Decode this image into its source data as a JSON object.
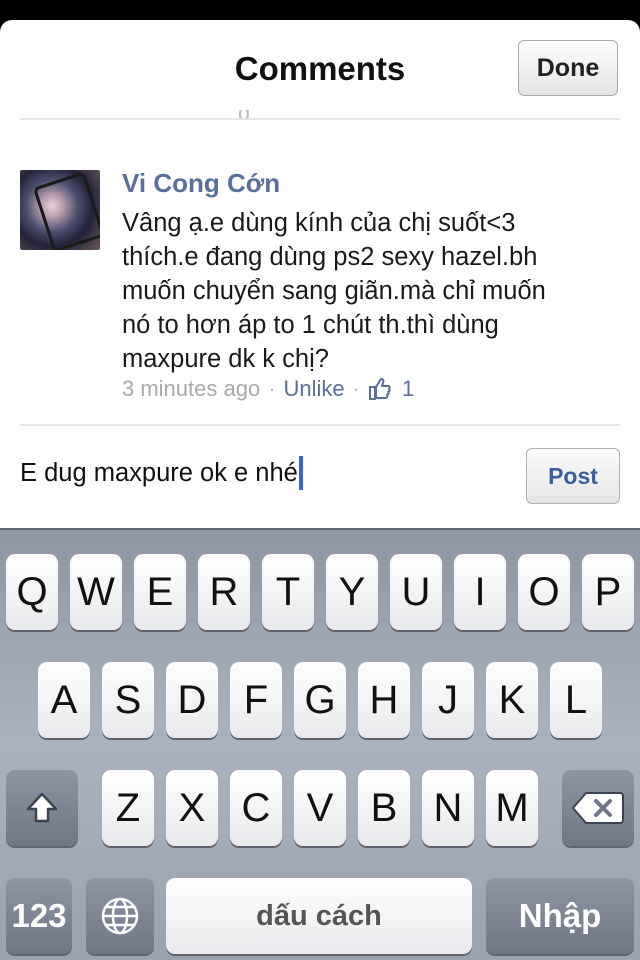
{
  "header": {
    "title": "Comments",
    "done_label": "Done"
  },
  "comment": {
    "author": "Vi Cong Cớn",
    "lines": [
      "Vâng ạ.e dùng kính của chị suốt<3",
      "thích.e đang dùng ps2 sexy hazel.bh",
      "muốn chuyển sang giãn.mà chỉ muốn",
      "nó to hơn áp to 1 chút th.thì dùng",
      "maxpure dk k chị?"
    ],
    "time": "3 minutes ago",
    "separator": "·",
    "unlike_label": "Unlike",
    "like_count": "1"
  },
  "composer": {
    "text": "E dug maxpure ok e nhé",
    "post_label": "Post"
  },
  "keyboard": {
    "row1": [
      "Q",
      "W",
      "E",
      "R",
      "T",
      "Y",
      "U",
      "I",
      "O",
      "P"
    ],
    "row2": [
      "A",
      "S",
      "D",
      "F",
      "G",
      "H",
      "J",
      "K",
      "L"
    ],
    "row3": [
      "Z",
      "X",
      "C",
      "V",
      "B",
      "N",
      "M"
    ],
    "numbers_label": "123",
    "space_label": "dấu cách",
    "return_label": "Nhập"
  },
  "colors": {
    "link": "#5a6f9c",
    "cursor": "#3e63d8",
    "post": "#3a5fa0"
  }
}
